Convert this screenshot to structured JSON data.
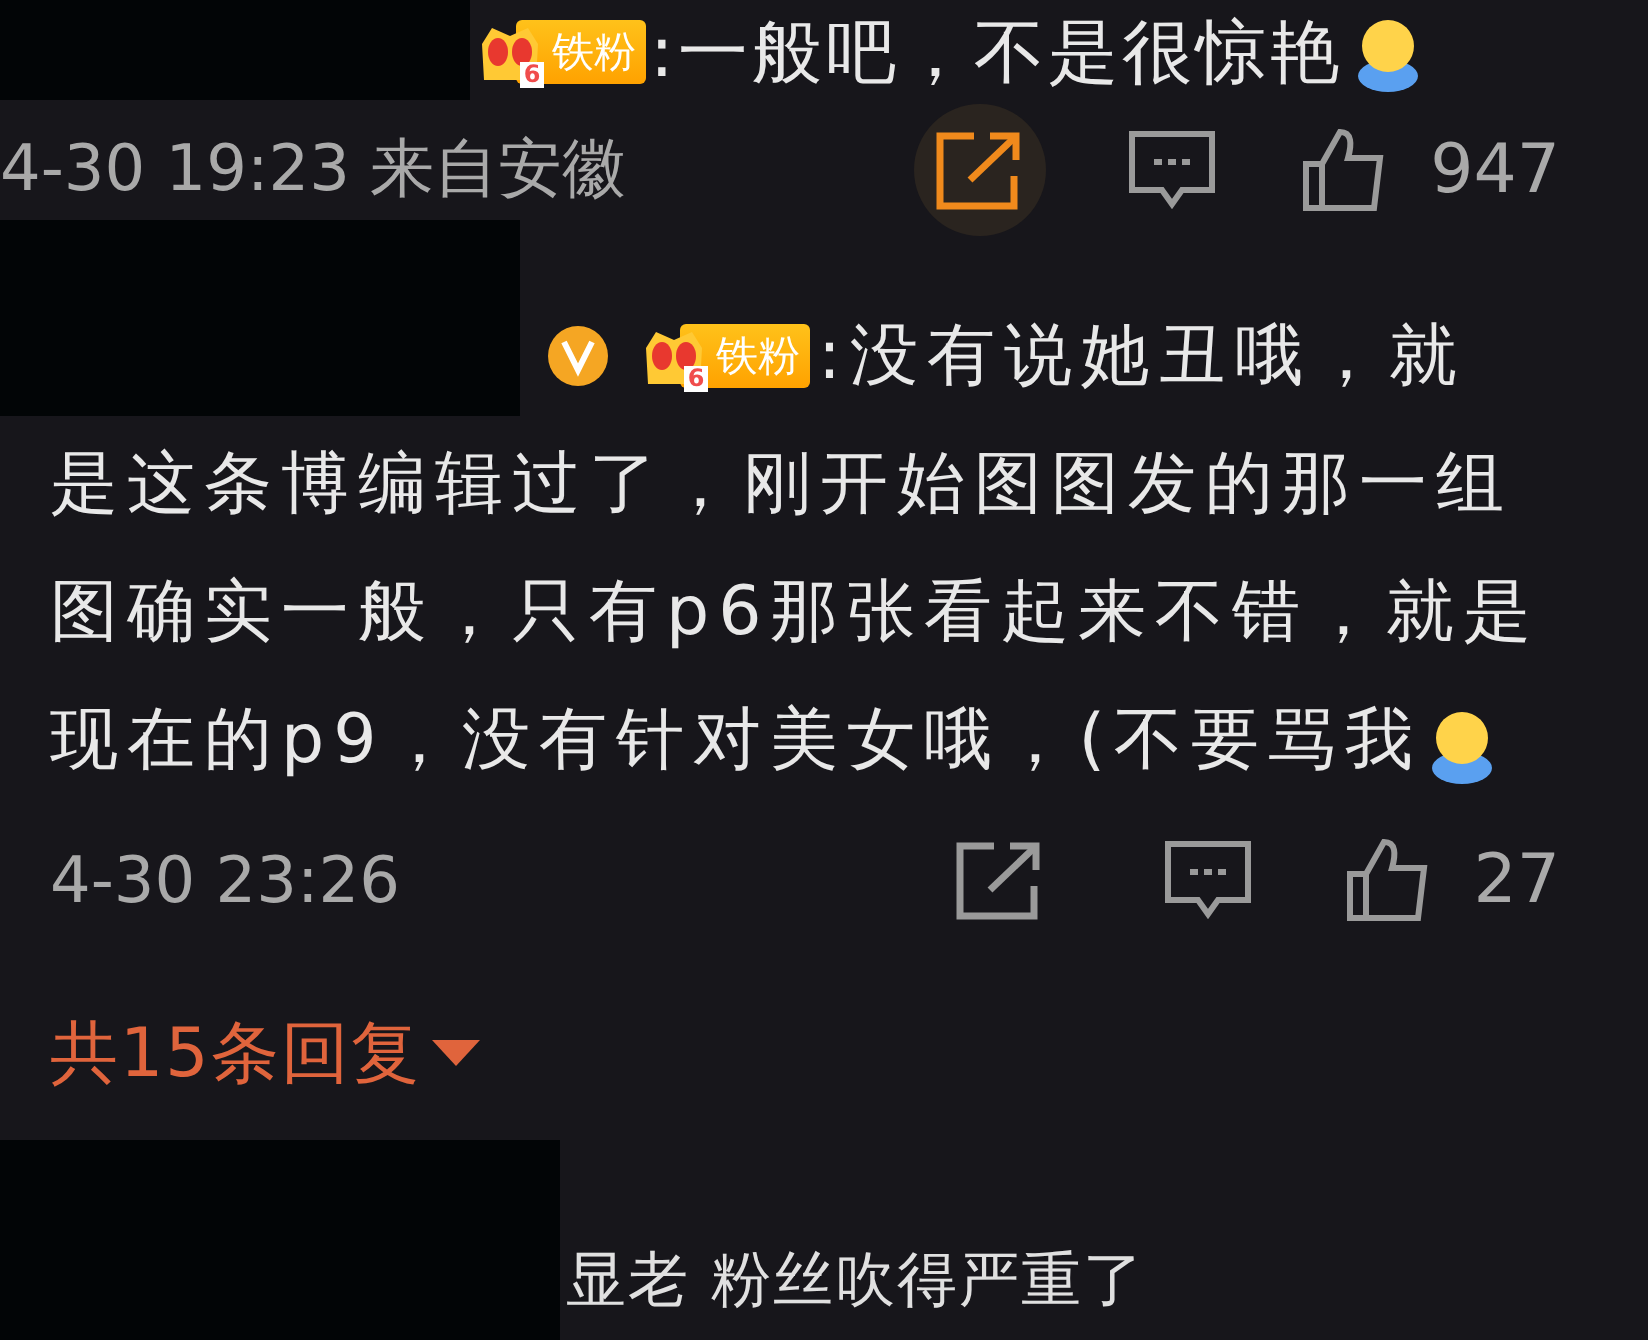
{
  "comments": [
    {
      "badge": {
        "label": "铁粉",
        "level": "6"
      },
      "verified": false,
      "text": ":一般吧，不是很惊艳",
      "emoji": true,
      "meta": "4-30 19:23 来自安徽",
      "share_highlighted": true,
      "likes": "947"
    },
    {
      "badge": {
        "label": "铁粉",
        "level": "6"
      },
      "verified": true,
      "text": ":没有说她丑哦，就",
      "text_continued": "是这条博编辑过了，刚开始图图发的那一组图确实一般，只有p6那张看起来不错，就是现在的p9，没有针对美女哦，(不要骂我",
      "emoji": true,
      "meta": "4-30 23:26",
      "share_highlighted": false,
      "likes": "27"
    }
  ],
  "replies_link": "共15条回复",
  "next_comment": {
    "text": "显老 粉丝吹得严重了"
  }
}
